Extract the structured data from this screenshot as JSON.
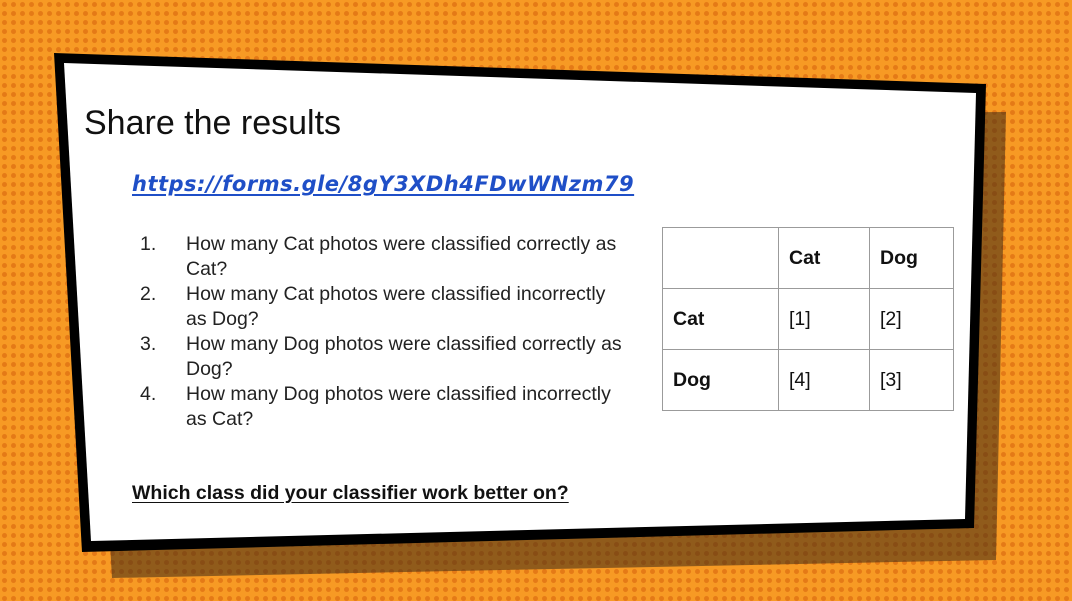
{
  "slide": {
    "title": "Share the results",
    "link": "https://forms.gle/8gY3XDh4FDwWNzm79",
    "questions": [
      {
        "number": "1.",
        "text": "How many Cat photos were classified correctly as Cat?"
      },
      {
        "number": "2.",
        "text": "How many Cat photos were classified incorrectly as Dog?"
      },
      {
        "number": "3.",
        "text": "How many Dog photos were classified correctly as Dog?"
      },
      {
        "number": "4.",
        "text": "How many Dog photos were classified incorrectly as Cat?"
      }
    ],
    "closing_question": "Which class did your classifier work better on?"
  },
  "table": {
    "corner": "",
    "col_headers": [
      "Cat",
      "Dog"
    ],
    "rows": [
      {
        "label": "Cat",
        "cells": [
          "[1]",
          "[2]"
        ]
      },
      {
        "label": "Dog",
        "cells": [
          "[4]",
          "[3]"
        ]
      }
    ]
  },
  "colors": {
    "background": "#f79a24",
    "dots": "#d6600c",
    "link": "#1f4fc7",
    "frame": "#000000"
  }
}
